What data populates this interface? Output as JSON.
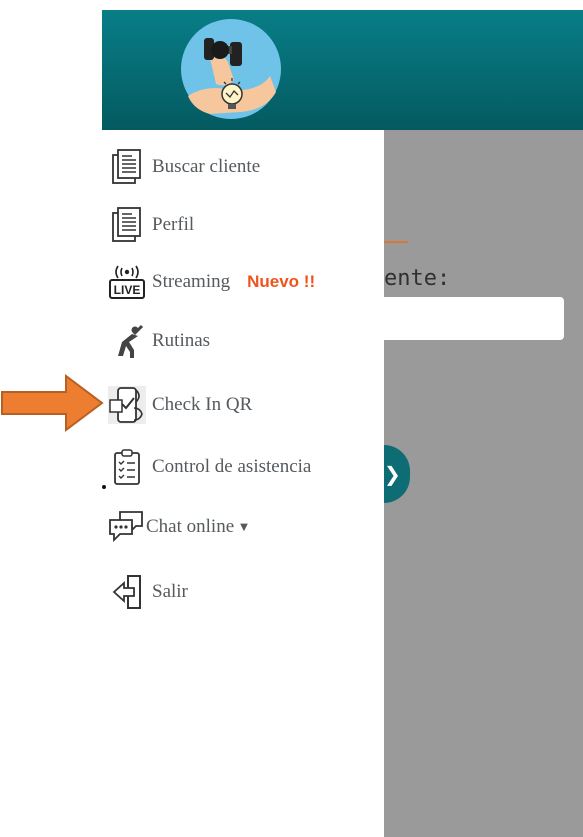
{
  "background_page": {
    "field_label": "ente:",
    "button_icon": "arrow-icon"
  },
  "menu": {
    "items": [
      {
        "label": "Buscar cliente",
        "icon": "document-icon"
      },
      {
        "label": "Perfil",
        "icon": "document-icon"
      },
      {
        "label": "Streaming",
        "icon": "live-broadcast-icon",
        "badge": "Nuevo !!"
      },
      {
        "label": "Rutinas",
        "icon": "stretching-person-icon"
      },
      {
        "label": "Check In QR",
        "icon": "phone-qr-check-icon"
      },
      {
        "label": "Control de asistencia",
        "icon": "clipboard-checklist-icon"
      },
      {
        "label": "Chat online",
        "icon": "chat-bubbles-icon",
        "has_dropdown": true
      },
      {
        "label": "Salir",
        "icon": "exit-door-icon"
      }
    ],
    "live_icon_text": "LIVE"
  },
  "colors": {
    "header": "#066a72",
    "badge": "#f0541c",
    "annotation_arrow": "#ed7d31",
    "overlay": "#9a9a9a"
  }
}
